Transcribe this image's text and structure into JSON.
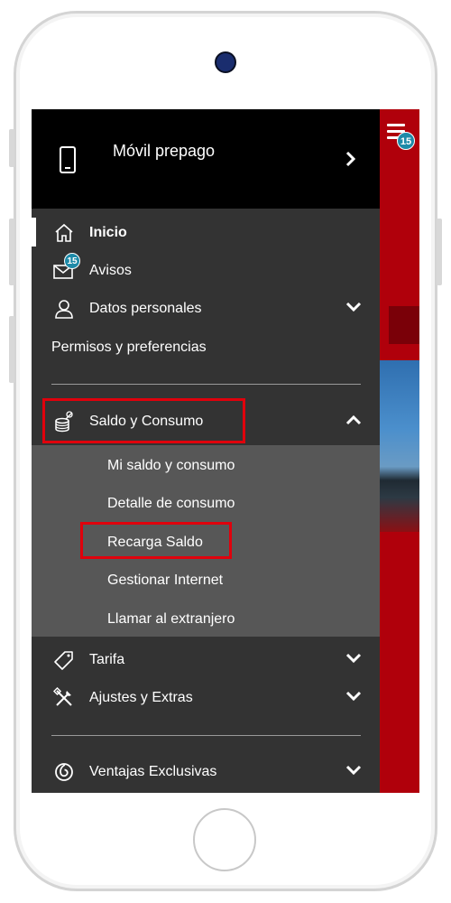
{
  "header": {
    "title": "Móvil prepago"
  },
  "notifications_count": "15",
  "menu": {
    "inicio": "Inicio",
    "avisos": "Avisos",
    "datos_personales": "Datos personales",
    "permisos": "Permisos y preferencias",
    "saldo_consumo": "Saldo y Consumo",
    "tarifa": "Tarifa",
    "ajustes": "Ajustes y Extras",
    "ventajas": "Ventajas Exclusivas"
  },
  "submenu": {
    "items": [
      "Mi saldo y consumo",
      "Detalle de consumo",
      "Recarga Saldo",
      "Gestionar Internet",
      "Llamar al extranjero"
    ]
  },
  "colors": {
    "brand_red": "#b0000b",
    "highlight_red": "#e0000c",
    "badge_teal": "#1e8aa8"
  }
}
